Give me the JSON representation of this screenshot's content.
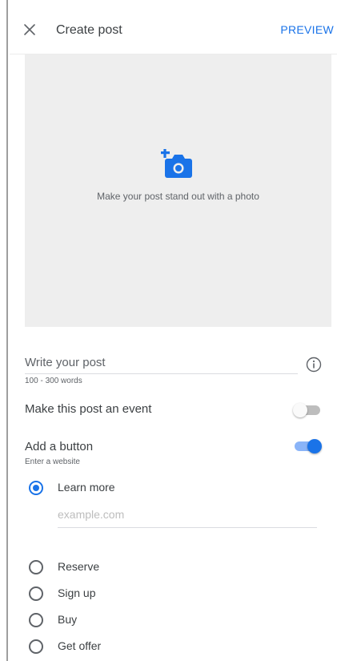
{
  "header": {
    "title": "Create post",
    "preview_label": "PREVIEW"
  },
  "photo": {
    "caption": "Make your post stand out with a photo",
    "icon": "add-photo-icon"
  },
  "post": {
    "placeholder": "Write your post",
    "hint": "100 - 300 words"
  },
  "event": {
    "label": "Make this post an event",
    "enabled": false
  },
  "button_section": {
    "label": "Add a button",
    "hint": "Enter a website",
    "enabled": true,
    "options": [
      {
        "label": "Learn more",
        "selected": true
      },
      {
        "label": "Reserve",
        "selected": false
      },
      {
        "label": "Sign up",
        "selected": false
      },
      {
        "label": "Buy",
        "selected": false
      },
      {
        "label": "Get offer",
        "selected": false
      }
    ],
    "url_placeholder": "example.com"
  },
  "colors": {
    "accent": "#1a73e8",
    "accent_light": "#8ab4f8",
    "photo_background": "#eeeeee"
  }
}
